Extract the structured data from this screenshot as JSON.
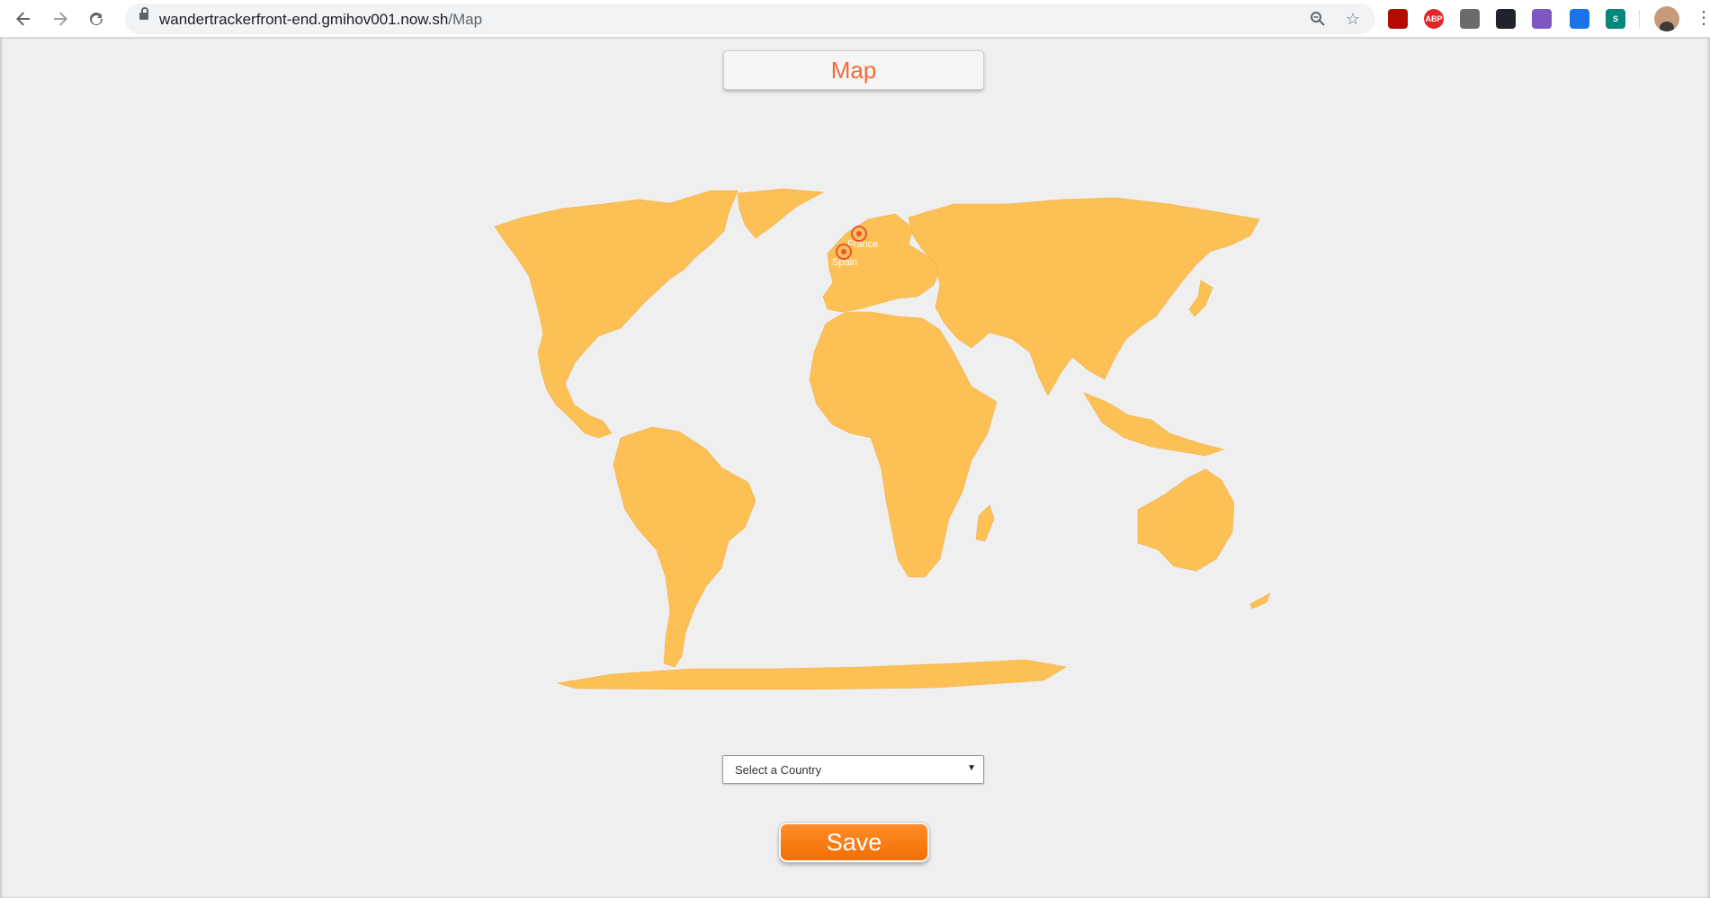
{
  "browser": {
    "url_host": "wandertrackerfront-end.gmihov001.now.sh",
    "url_path": "/Map",
    "extensions": [
      {
        "name": "pdf-extension-icon",
        "text": "",
        "color": "#b30b00"
      },
      {
        "name": "adblock-extension-icon",
        "text": "ABP",
        "color": "#e2252b"
      },
      {
        "name": "shield-extension-icon",
        "text": "",
        "color": "#6b6b6b"
      },
      {
        "name": "react-devtools-icon",
        "text": "",
        "color": "#20232a"
      },
      {
        "name": "color-wheel-extension-icon",
        "text": "",
        "color": "#7e57c2"
      },
      {
        "name": "eyedropper-extension-icon",
        "text": "",
        "color": "#1a73e8"
      },
      {
        "name": "s-extension-icon",
        "text": "S",
        "color": "#00897b"
      }
    ]
  },
  "page": {
    "title": "Map",
    "map": {
      "land_color": "#fcc055",
      "marker_color": "#e8543a",
      "markers": [
        {
          "label": "France"
        },
        {
          "label": "Spain"
        }
      ]
    },
    "country_select": {
      "selected": "Select a Country"
    },
    "save_label": "Save"
  }
}
